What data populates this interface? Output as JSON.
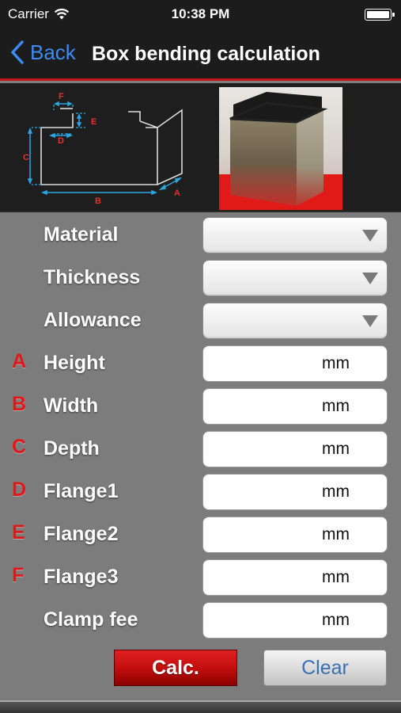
{
  "status_bar": {
    "carrier": "Carrier",
    "time": "10:38 PM"
  },
  "nav": {
    "back_label": "Back",
    "title": "Box bending calculation"
  },
  "diagram_labels": {
    "a": "A",
    "b": "B",
    "c": "C",
    "d": "D",
    "e": "E",
    "f": "F"
  },
  "selects": [
    {
      "label": "Material",
      "value": ""
    },
    {
      "label": "Thickness",
      "value": ""
    },
    {
      "label": "Allowance",
      "value": ""
    }
  ],
  "inputs": [
    {
      "letter": "A",
      "label": "Height",
      "unit": "mm",
      "value": ""
    },
    {
      "letter": "B",
      "label": "Width",
      "unit": "mm",
      "value": ""
    },
    {
      "letter": "C",
      "label": "Depth",
      "unit": "mm",
      "value": ""
    },
    {
      "letter": "D",
      "label": "Flange1",
      "unit": "mm",
      "value": ""
    },
    {
      "letter": "E",
      "label": "Flange2",
      "unit": "mm",
      "value": ""
    },
    {
      "letter": "F",
      "label": "Flange3",
      "unit": "mm",
      "value": ""
    },
    {
      "letter": "",
      "label": "Clamp fee",
      "unit": "mm",
      "value": ""
    }
  ],
  "buttons": {
    "calc_label": "Calc.",
    "clear_label": "Clear"
  },
  "colors": {
    "accent_red": "#c4161c",
    "back_blue": "#3b8cf5",
    "diagram_blue": "#2aa7e0",
    "label_red": "#e01818"
  }
}
